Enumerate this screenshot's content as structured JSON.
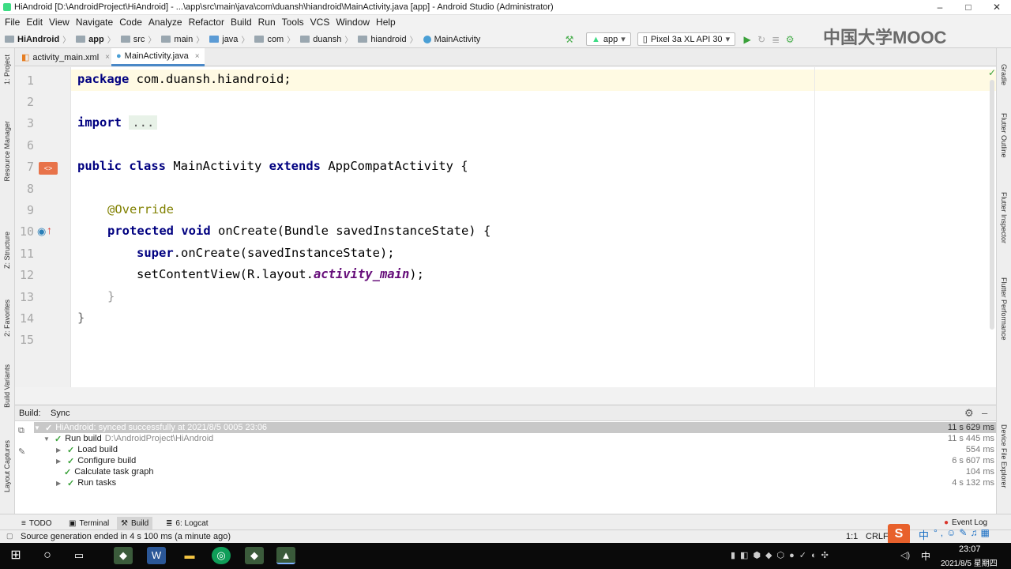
{
  "window": {
    "title": "HiAndroid [D:\\AndroidProject\\HiAndroid] - ...\\app\\src\\main\\java\\com\\duansh\\hiandroid\\MainActivity.java [app] - Android Studio (Administrator)",
    "minimize": "–",
    "maximize": "□",
    "close": "✕"
  },
  "menu": [
    "File",
    "Edit",
    "View",
    "Navigate",
    "Code",
    "Analyze",
    "Refactor",
    "Build",
    "Run",
    "Tools",
    "VCS",
    "Window",
    "Help"
  ],
  "breadcrumbs": [
    "HiAndroid",
    "app",
    "src",
    "main",
    "java",
    "com",
    "duansh",
    "hiandroid",
    "MainActivity"
  ],
  "toolbar": {
    "run_config": "app",
    "device": "Pixel 3a XL API 30",
    "hammer_icon": "⚒",
    "run_icon": "▶",
    "debug_icon": "⚙"
  },
  "watermark": "中国大学MOOC",
  "left_tabs": [
    "1: Project",
    "Resource Manager",
    "Z: Structure",
    "2: Favorites",
    "Build Variants",
    "Layout Captures"
  ],
  "right_tabs": [
    "Gradle",
    "Flutter Outline",
    "Flutter Inspector",
    "Flutter Performance",
    "Device File Explorer"
  ],
  "editor_tabs": [
    {
      "label": "activity_main.xml",
      "close": "×"
    },
    {
      "label": "MainActivity.java",
      "close": "×"
    }
  ],
  "code": {
    "line_numbers": [
      "1",
      "2",
      "3",
      "6",
      "7",
      "8",
      "9",
      "10",
      "11",
      "12",
      "13",
      "14",
      "15"
    ],
    "l1_kw": "package",
    "l1_rest": " com.duansh.hiandroid;",
    "l3_kw": "import",
    "l3_dots": "...",
    "l7_kw1": "public",
    "l7_kw2": "class",
    "l7_name": " MainActivity ",
    "l7_kw3": "extends",
    "l7_rest": " AppCompatActivity {",
    "l9_ann": "@Override",
    "l10_kw1": "protected",
    "l10_kw2": "void",
    "l10_rest": " onCreate(Bundle savedInstanceState) {",
    "l11_kw": "super",
    "l11_rest": ".onCreate(savedInstanceState);",
    "l12_a": "setContentView(R.layout.",
    "l12_it": "activity_main",
    "l12_b": ");",
    "l13": "}",
    "l14": "}"
  },
  "build": {
    "header_build": "Build:",
    "header_sync": "Sync",
    "rows": [
      {
        "label": "HiAndroid: synced successfully at 2021/8/5 0005 23:06",
        "time": "11 s 629 ms"
      },
      {
        "label": "Run build",
        "path": "D:\\AndroidProject\\HiAndroid",
        "time": "11 s 445 ms"
      },
      {
        "label": "Load build",
        "time": "554 ms"
      },
      {
        "label": "Configure build",
        "time": "6 s 607 ms"
      },
      {
        "label": "Calculate task graph",
        "time": "104 ms"
      },
      {
        "label": "Run tasks",
        "time": "4 s 132 ms"
      }
    ]
  },
  "tool_windows": [
    "TODO",
    "Terminal",
    "Build",
    "6: Logcat"
  ],
  "event_log": "Event Log",
  "status": {
    "message": "Source generation ended in 4 s 100 ms (a minute ago)",
    "position": "1:1",
    "line_sep": "CRLF"
  },
  "ime": "中",
  "taskbar": {
    "time": "23:07",
    "date": "2021/8/5 星期四",
    "lang": "中"
  },
  "colors": {
    "keyword": "#000080",
    "annotation": "#808000",
    "italic_field": "#660e7a",
    "success": "#3aa13a",
    "accent": "#4a88c7"
  }
}
